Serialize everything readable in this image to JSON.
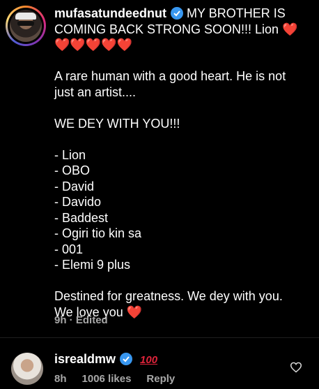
{
  "comment": {
    "username": "mufasatundeednut",
    "lines": [
      "MY BROTHER IS",
      "COMING BACK STRONG SOON!!! Lion",
      "A rare human with a good heart. He is not",
      "just an artist....",
      "WE DEY WITH YOU!!!",
      "- Lion",
      "- OBO",
      "- David",
      "- Davido",
      "- Baddest",
      "- Ogiri tio kin sa",
      "- 001",
      "- Elemi 9 plus",
      "Destined for greatness. We dey with you.",
      "We love you"
    ],
    "hearts_row": "❤️❤️❤️❤️❤️",
    "heart": "❤️",
    "time": "9h",
    "edited": "Edited"
  },
  "reply": {
    "username": "isrealdmw",
    "emoji": "100",
    "time": "8h",
    "likes": "1006 likes",
    "reply_label": "Reply"
  },
  "colors": {
    "verified": "#3897f0",
    "meta": "#a8a8a8",
    "heart": "#ed2940"
  }
}
